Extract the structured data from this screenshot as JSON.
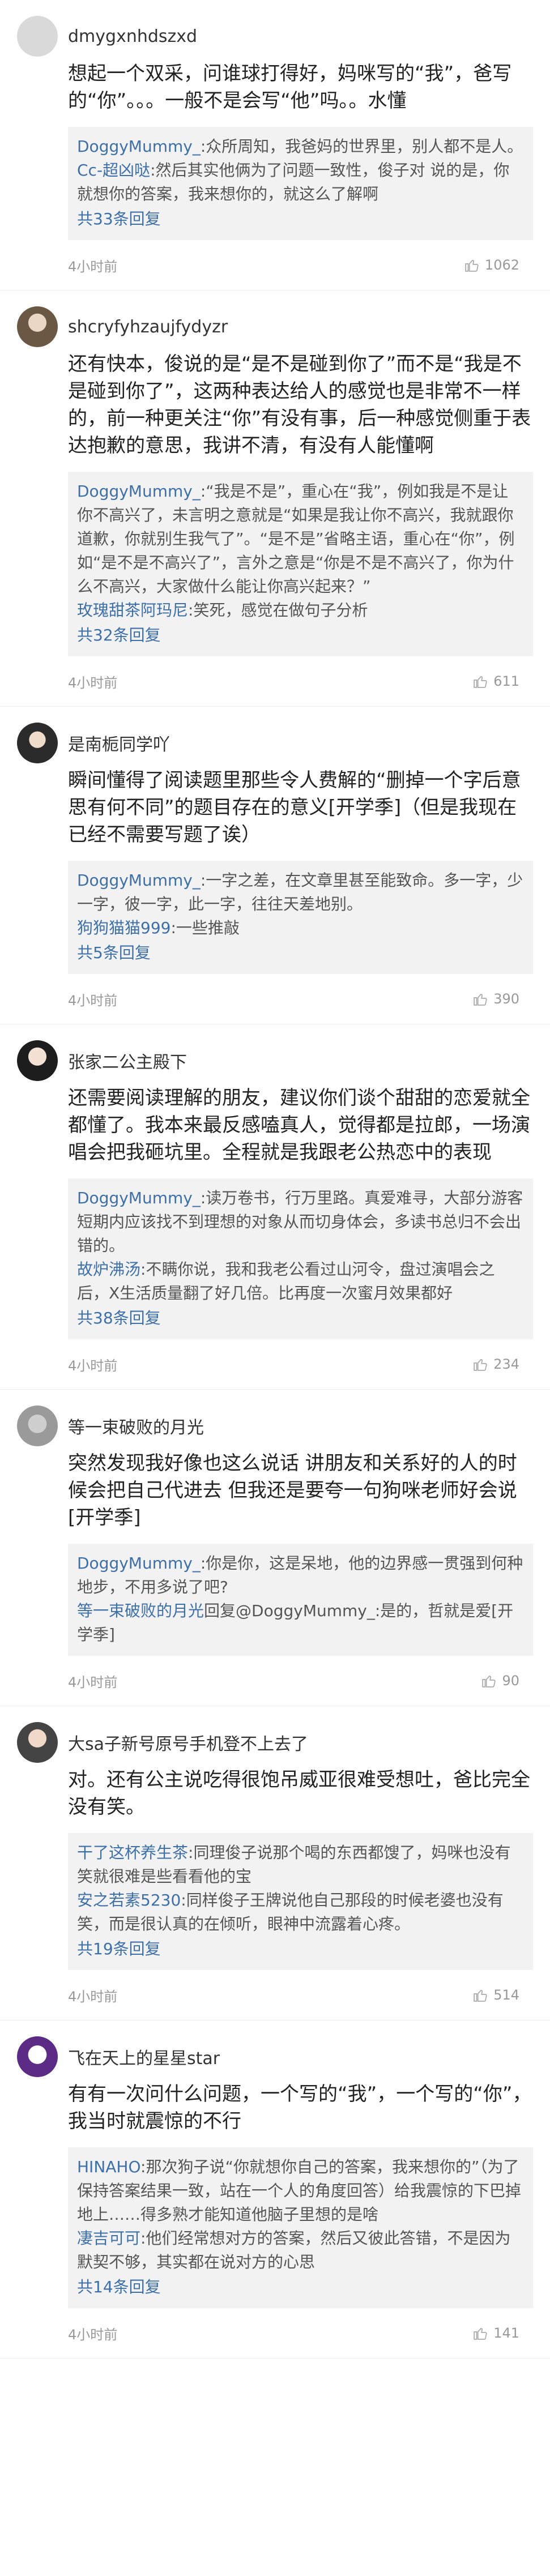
{
  "comments": [
    {
      "user": "dmygxnhdszxd",
      "text": "想起一个双采，问谁球打得好，妈咪写的“我”，爸写的“你”。。。一般不是会写“他”吗。。水懂",
      "replies": [
        {
          "name": "DoggyMummy_",
          "text": ":众所周知，我爸妈的世界里，别人都不是人。"
        },
        {
          "name": "Cc-超凶哒",
          "text": ":然后其实他俩为了问题一致性，俊子对 说的是，你就想你的答案，我来想你的，就这么了解啊"
        }
      ],
      "more": "共33条回复",
      "time": "4小时前",
      "likes": "1062"
    },
    {
      "user": "shcryfyhzaujfydyzr",
      "text": "还有快本，俊说的是“是不是碰到你了”而不是“我是不是碰到你了”，这两种表达给人的感觉也是非常不一样的，前一种更关注“你”有没有事，后一种感觉侧重于表达抱歉的意思，我讲不清，有没有人能懂啊",
      "replies": [
        {
          "name": "DoggyMummy_",
          "text": ":“我是不是”，重心在“我”，例如我是不是让你不高兴了，未言明之意就是“如果是我让你不高兴，我就跟你道歉，你就别生我气了”。“是不是”省略主语，重心在“你”，例如“是不是不高兴了”，言外之意是“你是不是不高兴了，你为什么不高兴，大家做什么能让你高兴起来？”"
        },
        {
          "name": "玫瑰甜茶阿玛尼",
          "text": ":笑死，感觉在做句子分析"
        }
      ],
      "more": "共32条回复",
      "time": "4小时前",
      "likes": "611"
    },
    {
      "user": "是南栀同学吖",
      "text": "瞬间懂得了阅读题里那些令人费解的“删掉一个字后意思有何不同”的题目存在的意义[开学季]（但是我现在已经不需要写题了诶）",
      "replies": [
        {
          "name": "DoggyMummy_",
          "text": ":一字之差，在文章里甚至能致命。多一字，少一字，彼一字，此一字，往往天差地别。"
        },
        {
          "name": "狗狗猫猫999",
          "text": ":一些推敲"
        }
      ],
      "more": "共5条回复",
      "time": "4小时前",
      "likes": "390"
    },
    {
      "user": "张家二公主殿下",
      "text": "还需要阅读理解的朋友，建议你们谈个甜甜的恋爱就全都懂了。我本来最反感嗑真人，觉得都是拉郎，一场演唱会把我砸坑里。全程就是我跟老公热恋中的表现",
      "replies": [
        {
          "name": "DoggyMummy_",
          "text": ":读万卷书，行万里路。真爱难寻，大部分游客短期内应该找不到理想的对象从而切身体会，多读书总归不会出错的。"
        },
        {
          "name": "故炉沸汤",
          "text": ":不瞒你说，我和我老公看过山河令，盘过演唱会之后，X生活质量翻了好几倍。比再度一次蜜月效果都好"
        }
      ],
      "more": "共38条回复",
      "time": "4小时前",
      "likes": "234"
    },
    {
      "user": "等一束破败的月光",
      "text": "突然发现我好像也这么说话 讲朋友和关系好的人的时候会把自己代进去 但我还是要夸一句狗咪老师好会说[开学季]",
      "replies": [
        {
          "name": "DoggyMummy_",
          "text": ":你是你，这是呆地，他的边界感一贯强到何种地步，不用多说了吧?"
        },
        {
          "name": "等一束破败的月光",
          "text": "回复@DoggyMummy_:是的，哲就是爱[开学季]"
        }
      ],
      "more": "",
      "time": "4小时前",
      "likes": "90"
    },
    {
      "user": "大sa子新号原号手机登不上去了",
      "text": "对。还有公主说吃得很饱吊威亚很难受想吐，爸比完全没有笑。",
      "replies": [
        {
          "name": "干了这杯养生茶",
          "text": ":同理俊子说那个喝的东西都馊了，妈咪也没有笑就很难是些看看他的宝"
        },
        {
          "name": "安之若素5230",
          "text": ":同样俊子王牌说他自己那段的时候老婆也没有笑，而是很认真的在倾听，眼神中流露着心疼。"
        }
      ],
      "more": "共19条回复",
      "time": "4小时前",
      "likes": "514"
    },
    {
      "user": "飞在天上的星星star",
      "text": "有有一次问什么问题，一个写的“我”，一个写的“你”，我当时就震惊的不行",
      "replies": [
        {
          "name": "HINAHO",
          "text": ":那次狗子说“你就想你自己的答案，我来想你的”（为了保持答案结果一致，站在一个人的角度回答）给我震惊的下巴掉地上……得多熟才能知道他脑子里想的是啥"
        },
        {
          "name": "凄吉可可",
          "text": ":他们经常想对方的答案，然后又彼此答错，不是因为默契不够，其实都在说对方的心思"
        }
      ],
      "more": "共14条回复",
      "time": "4小时前",
      "likes": "141"
    }
  ],
  "colors": {
    "name_link": "#3d6fa8",
    "reply_bg": "#f2f2f2",
    "meta": "#999999"
  },
  "icons": {
    "like": "thumb-up-icon"
  }
}
